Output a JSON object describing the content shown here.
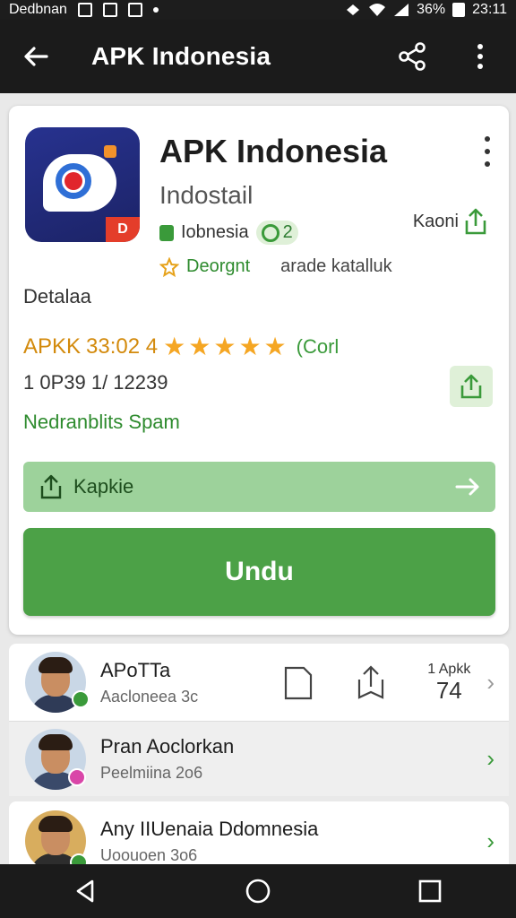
{
  "status_bar": {
    "left_text": "Dedbnan",
    "battery": "36%",
    "time": "23:11"
  },
  "app_bar": {
    "title": "APK Indonesia",
    "back_icon": "arrow-left-icon",
    "share_icon": "share-icon",
    "more_icon": "more-vert-icon"
  },
  "app": {
    "name": "APK Indonesia",
    "developer": "Indostail",
    "region_label": "Iobnesia",
    "region_count": "2",
    "right_label": "Kaoni",
    "badge_label": "Deorgnt",
    "category": "arade katalluk",
    "section_label": "Detalaa",
    "rating_prefix": "APKK",
    "rating_mid": "33:02 4",
    "rating_count": "(Corl",
    "downloads": "1 0P39 1/ 12239",
    "tagline": "Nedranblits Spam",
    "share_bar_label": "Kapkie",
    "install_label": "Undu"
  },
  "list": [
    {
      "title": "APoTTa",
      "subtitle": "Aacloneea 3c",
      "code_top": "1 Apkk",
      "code_big": "74",
      "status_color": "#3a9a3a"
    },
    {
      "title": "Pran Aoclorkan",
      "subtitle": "Peelmiina 2o6",
      "status_color": "#d946a8"
    },
    {
      "title": "Any IIUenaia Ddomnesia",
      "subtitle": "Uoouoen 3o6",
      "status_color": "#3a9a3a"
    }
  ],
  "colors": {
    "accent_green": "#4ca147",
    "app_bar": "#1b1b1b",
    "star": "#f5a623"
  }
}
